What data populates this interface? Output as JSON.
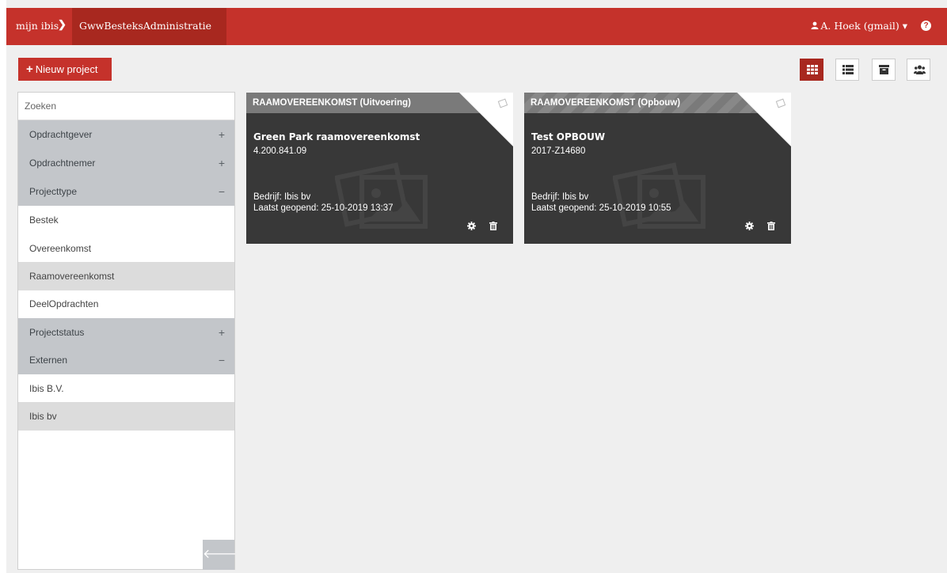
{
  "header": {
    "home_label": "mijn ibis",
    "separator": "❯",
    "current_label": "GwwBesteksAdministratie",
    "user_label": "A. Hoek (gmail) ▾",
    "help_label": "?"
  },
  "toolbar": {
    "new_project_label": "Nieuw project",
    "new_project_plus": "+",
    "views": [
      {
        "name": "grid-view",
        "icon": "grid-icon",
        "active": true
      },
      {
        "name": "list-view",
        "icon": "list-icon",
        "active": false
      },
      {
        "name": "archive",
        "icon": "archive-icon",
        "active": false
      },
      {
        "name": "users",
        "icon": "users-icon",
        "active": false
      }
    ]
  },
  "sidebar": {
    "search_placeholder": "Zoeken",
    "rows": [
      {
        "label": "Opdrachtgever",
        "kind": "group",
        "toggle": "+"
      },
      {
        "label": "Opdrachtnemer",
        "kind": "group",
        "toggle": "+"
      },
      {
        "label": "Projecttype",
        "kind": "group",
        "toggle": "−"
      },
      {
        "label": "Bestek",
        "kind": "option",
        "selected": false
      },
      {
        "label": "Overeenkomst",
        "kind": "option",
        "selected": false
      },
      {
        "label": "Raamovereenkomst",
        "kind": "option",
        "selected": true
      },
      {
        "label": "DeelOpdrachten",
        "kind": "option",
        "selected": false
      },
      {
        "label": "Projectstatus",
        "kind": "group",
        "toggle": "+"
      },
      {
        "label": "Externen",
        "kind": "group",
        "toggle": "−"
      },
      {
        "label": "Ibis B.V.",
        "kind": "option",
        "selected": false
      },
      {
        "label": "Ibis bv",
        "kind": "option",
        "selected": true
      }
    ],
    "collapse_label": "🡐"
  },
  "cards": [
    {
      "header": "RAAMOVEREENKOMST (Uitvoering)",
      "title": "Green Park raamovereenkomst",
      "code": "4.200.841.09",
      "company": "Bedrijf: Ibis bv",
      "last_opened": "Laatst geopend: 25-10-2019 13:37"
    },
    {
      "header": "RAAMOVEREENKOMST (Opbouw)",
      "title": "Test OPBOUW",
      "code": "2017-Z14680",
      "company": "Bedrijf: Ibis bv",
      "last_opened": "Laatst geopend: 25-10-2019 10:55"
    }
  ],
  "colors": {
    "brand": "#c5322b",
    "brand_dark": "#a8281f",
    "filter_group": "#c3c6ca",
    "card_bg": "#383838"
  }
}
